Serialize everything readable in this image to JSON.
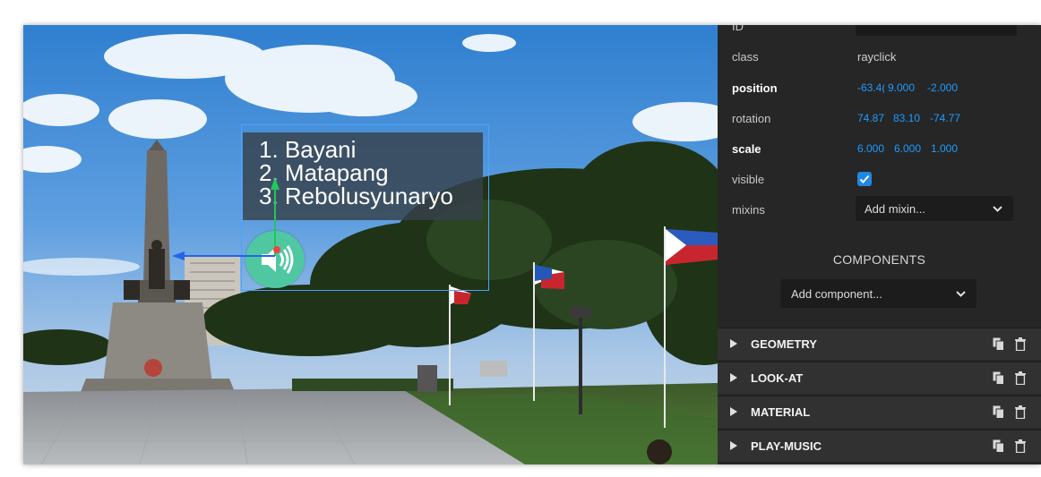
{
  "scene": {
    "text_panel": {
      "lines": [
        "1. Bayani",
        "2. Matapang",
        "3. Rebolusyunaryo"
      ]
    },
    "speaker_icon": "speaker-volume-icon"
  },
  "inspector": {
    "id_label": "ID",
    "class_label": "class",
    "class_value": "rayclick",
    "position_label": "position",
    "position_values": [
      "-63.4(",
      "9.000",
      "-2.000"
    ],
    "rotation_label": "rotation",
    "rotation_values": [
      "74.87",
      "83.10",
      "-74.77"
    ],
    "scale_label": "scale",
    "scale_values": [
      "6.000",
      "6.000",
      "1.000"
    ],
    "visible_label": "visible",
    "visible_checked": true,
    "mixins_label": "mixins",
    "mixins_select": "Add mixin...",
    "components_title": "COMPONENTS",
    "add_component_select": "Add component...",
    "sections": [
      {
        "name": "GEOMETRY"
      },
      {
        "name": "LOOK-AT"
      },
      {
        "name": "MATERIAL"
      },
      {
        "name": "PLAY-MUSIC"
      }
    ],
    "accent_color": "#1e9bff",
    "checkbox_color": "#1e88e5"
  }
}
